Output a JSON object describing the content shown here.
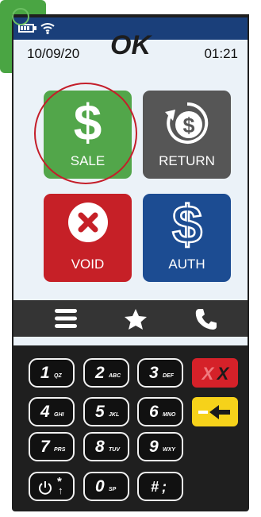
{
  "status": {
    "date": "10/09/20",
    "time": "01:21"
  },
  "tiles": {
    "sale": {
      "label": "SALE",
      "glyph": "$",
      "color": "#52a64a"
    },
    "return": {
      "label": "RETURN",
      "color": "#565656"
    },
    "void": {
      "label": "VOID",
      "color": "#c62027"
    },
    "auth": {
      "label": "AUTH",
      "color": "#1c4c92"
    }
  },
  "navbar": {
    "items": [
      {
        "icon": "menu-icon"
      },
      {
        "icon": "star-icon"
      },
      {
        "icon": "phone-icon"
      }
    ]
  },
  "keypad": {
    "keys": [
      {
        "num": "1",
        "sub": "QZ"
      },
      {
        "num": "2",
        "sub": "ABC"
      },
      {
        "num": "3",
        "sub": "DEF"
      },
      {
        "num": "4",
        "sub": "GHI"
      },
      {
        "num": "5",
        "sub": "JKL"
      },
      {
        "num": "6",
        "sub": "MNO"
      },
      {
        "num": "7",
        "sub": "PRS"
      },
      {
        "num": "8",
        "sub": "TUV"
      },
      {
        "num": "9",
        "sub": "WXY"
      },
      {
        "num": "*",
        "sub": ""
      },
      {
        "num": "0",
        "sub": "SP"
      },
      {
        "num": "#;",
        "sub": ""
      }
    ],
    "cancel": {
      "glyph": "X",
      "color": "#d52129"
    },
    "clear": {
      "color": "#f6d21a"
    },
    "ok": {
      "label": "OK",
      "color": "#4aa543"
    }
  }
}
